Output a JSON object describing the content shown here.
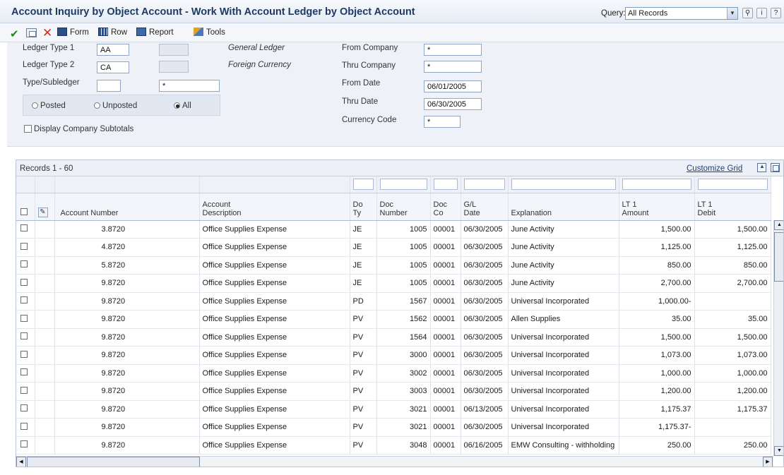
{
  "window": {
    "title": "Account Inquiry by Object Account - Work With Account Ledger by Object Account",
    "query_label": "Query:",
    "query_value": "All Records"
  },
  "toolbar": {
    "form": "Form",
    "row": "Row",
    "report": "Report",
    "tools": "Tools"
  },
  "form": {
    "ledger_type_1_label": "Ledger Type 1",
    "ledger_type_1": "AA",
    "ledger_type_2_label": "Ledger Type 2",
    "ledger_type_2": "CA",
    "type_subledger_label": "Type/Subledger",
    "type_subledger": "",
    "subledger": "*",
    "general_ledger": "General Ledger",
    "foreign_currency": "Foreign Currency",
    "from_company_label": "From Company",
    "from_company": "*",
    "thru_company_label": "Thru Company",
    "thru_company": "*",
    "from_date_label": "From Date",
    "from_date": "06/01/2005",
    "thru_date_label": "Thru Date",
    "thru_date": "06/30/2005",
    "currency_code_label": "Currency Code",
    "currency_code": "*",
    "posted": "Posted",
    "unposted": "Unposted",
    "all": "All",
    "selected_option": "All",
    "display_subtotals": "Display Company Subtotals"
  },
  "grid": {
    "records": "Records 1 - 60",
    "customize": "Customize Grid",
    "headers": {
      "account_number": "Account Number",
      "account_desc_1": "Account",
      "account_desc_2": "Description",
      "do_ty_1": "Do",
      "do_ty_2": "Ty",
      "doc_number_1": "Doc",
      "doc_number_2": "Number",
      "doc_co_1": "Doc",
      "doc_co_2": "Co",
      "gl_date_1": "G/L",
      "gl_date_2": "Date",
      "explanation": "Explanation",
      "amount_1": "LT 1",
      "amount_2": "Amount",
      "debit_1": "LT 1",
      "debit_2": "Debit"
    },
    "rows": [
      {
        "account": "3.8720",
        "desc": "Office Supplies Expense",
        "doty": "JE",
        "docnum": "1005",
        "docco": "00001",
        "gldate": "06/30/2005",
        "expl": "June Activity",
        "amount": "1,500.00",
        "debit": "1,500.00"
      },
      {
        "account": "4.8720",
        "desc": "Office Supplies Expense",
        "doty": "JE",
        "docnum": "1005",
        "docco": "00001",
        "gldate": "06/30/2005",
        "expl": "June Activity",
        "amount": "1,125.00",
        "debit": "1,125.00"
      },
      {
        "account": "5.8720",
        "desc": "Office Supplies Expense",
        "doty": "JE",
        "docnum": "1005",
        "docco": "00001",
        "gldate": "06/30/2005",
        "expl": "June Activity",
        "amount": "850.00",
        "debit": "850.00"
      },
      {
        "account": "9.8720",
        "desc": "Office Supplies Expense",
        "doty": "JE",
        "docnum": "1005",
        "docco": "00001",
        "gldate": "06/30/2005",
        "expl": "June Activity",
        "amount": "2,700.00",
        "debit": "2,700.00"
      },
      {
        "account": "9.8720",
        "desc": "Office Supplies Expense",
        "doty": "PD",
        "docnum": "1567",
        "docco": "00001",
        "gldate": "06/30/2005",
        "expl": "Universal Incorporated",
        "amount": "1,000.00-",
        "debit": ""
      },
      {
        "account": "9.8720",
        "desc": "Office Supplies Expense",
        "doty": "PV",
        "docnum": "1562",
        "docco": "00001",
        "gldate": "06/30/2005",
        "expl": "Allen Supplies",
        "amount": "35.00",
        "debit": "35.00"
      },
      {
        "account": "9.8720",
        "desc": "Office Supplies Expense",
        "doty": "PV",
        "docnum": "1564",
        "docco": "00001",
        "gldate": "06/30/2005",
        "expl": "Universal Incorporated",
        "amount": "1,500.00",
        "debit": "1,500.00"
      },
      {
        "account": "9.8720",
        "desc": "Office Supplies Expense",
        "doty": "PV",
        "docnum": "3000",
        "docco": "00001",
        "gldate": "06/30/2005",
        "expl": "Universal Incorporated",
        "amount": "1,073.00",
        "debit": "1,073.00"
      },
      {
        "account": "9.8720",
        "desc": "Office Supplies Expense",
        "doty": "PV",
        "docnum": "3002",
        "docco": "00001",
        "gldate": "06/30/2005",
        "expl": "Universal Incorporated",
        "amount": "1,000.00",
        "debit": "1,000.00"
      },
      {
        "account": "9.8720",
        "desc": "Office Supplies Expense",
        "doty": "PV",
        "docnum": "3003",
        "docco": "00001",
        "gldate": "06/30/2005",
        "expl": "Universal Incorporated",
        "amount": "1,200.00",
        "debit": "1,200.00"
      },
      {
        "account": "9.8720",
        "desc": "Office Supplies Expense",
        "doty": "PV",
        "docnum": "3021",
        "docco": "00001",
        "gldate": "06/13/2005",
        "expl": "Universal Incorporated",
        "amount": "1,175.37",
        "debit": "1,175.37"
      },
      {
        "account": "9.8720",
        "desc": "Office Supplies Expense",
        "doty": "PV",
        "docnum": "3021",
        "docco": "00001",
        "gldate": "06/30/2005",
        "expl": "Universal Incorporated",
        "amount": "1,175.37-",
        "debit": ""
      },
      {
        "account": "9.8720",
        "desc": "Office Supplies Expense",
        "doty": "PV",
        "docnum": "3048",
        "docco": "00001",
        "gldate": "06/16/2005",
        "expl": "EMW Consulting - withholding",
        "amount": "250.00",
        "debit": "250.00"
      }
    ]
  }
}
